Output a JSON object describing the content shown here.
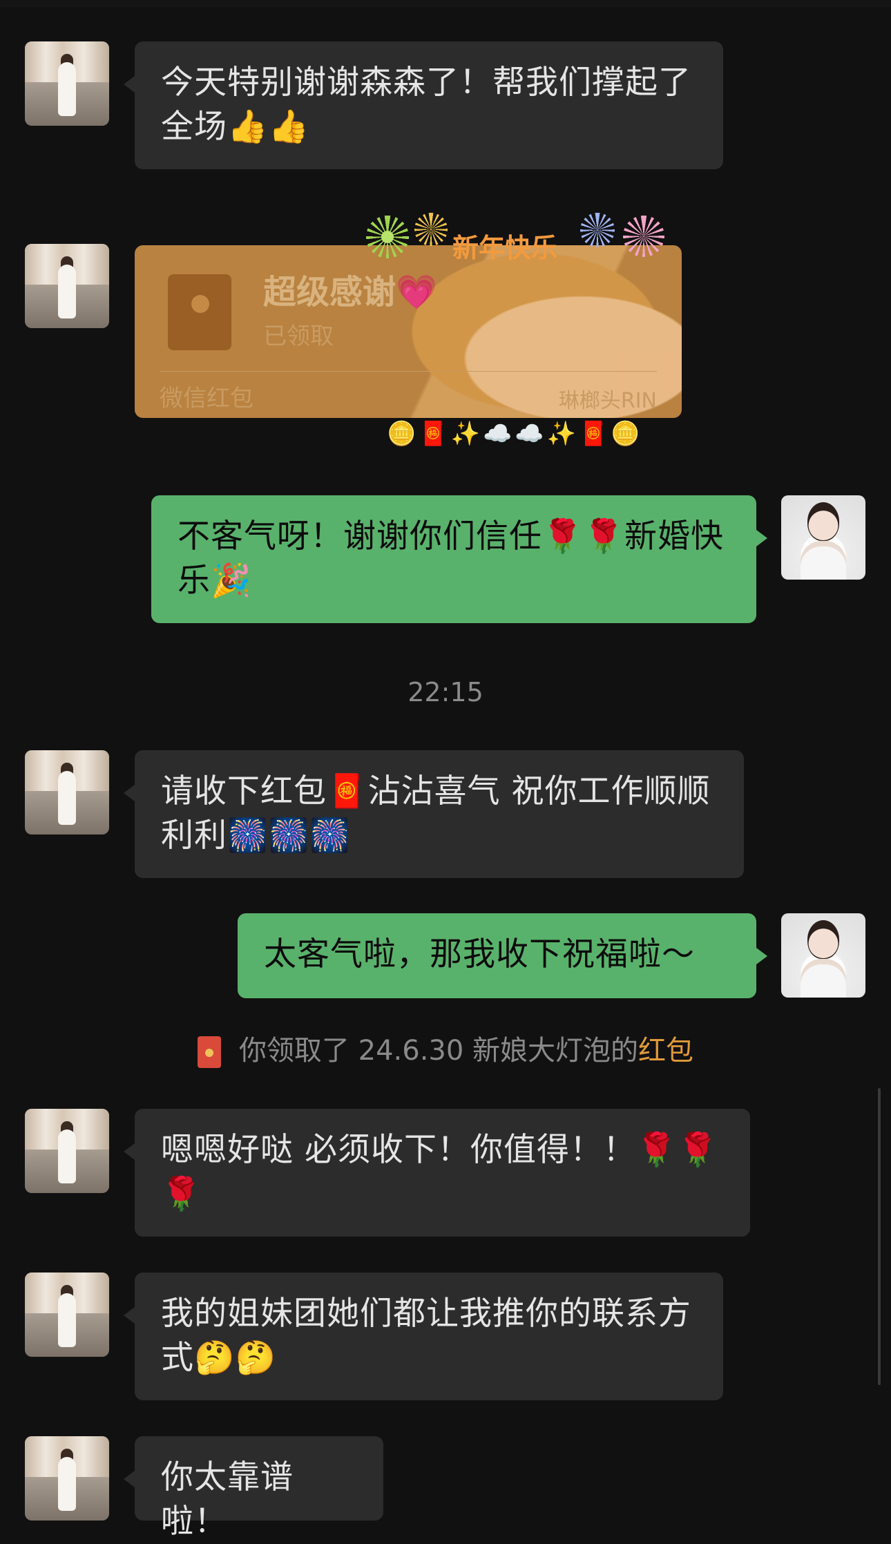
{
  "messages": {
    "m1": "今天特别谢谢森森了！帮我们撑起了全场👍👍",
    "m3": "不客气呀！谢谢你们信任🌹🌹新婚快乐🎉",
    "m4": "请收下红包🧧沾沾喜气 祝你工作顺顺利利🎆🎆🎆",
    "m5": "太客气啦，那我收下祝福啦～",
    "m6": "嗯嗯好哒 必须收下！你值得！！🌹🌹🌹",
    "m7": "我的姐妹团她们都让我推你的联系方式🤔🤔",
    "m8": "你太靠谱啦！"
  },
  "red_packet": {
    "title": "超级感谢💗",
    "status": "已领取",
    "footer": "微信红包",
    "brand": "琳榔头RIN",
    "sticker_caption": "新年快乐"
  },
  "timestamp": "22:15",
  "system_message": {
    "prefix": "你领取了 24.6.30 新娘大灯泡的",
    "link": "红包"
  },
  "colors": {
    "background": "#111111",
    "incoming_bubble": "#2c2c2c",
    "outgoing_bubble": "#59b26b",
    "red_packet": "#b98240",
    "highlight": "#e19a3a"
  },
  "icons": [
    "avatar-left",
    "avatar-right",
    "red-envelope-icon",
    "firework-decor-icons"
  ]
}
